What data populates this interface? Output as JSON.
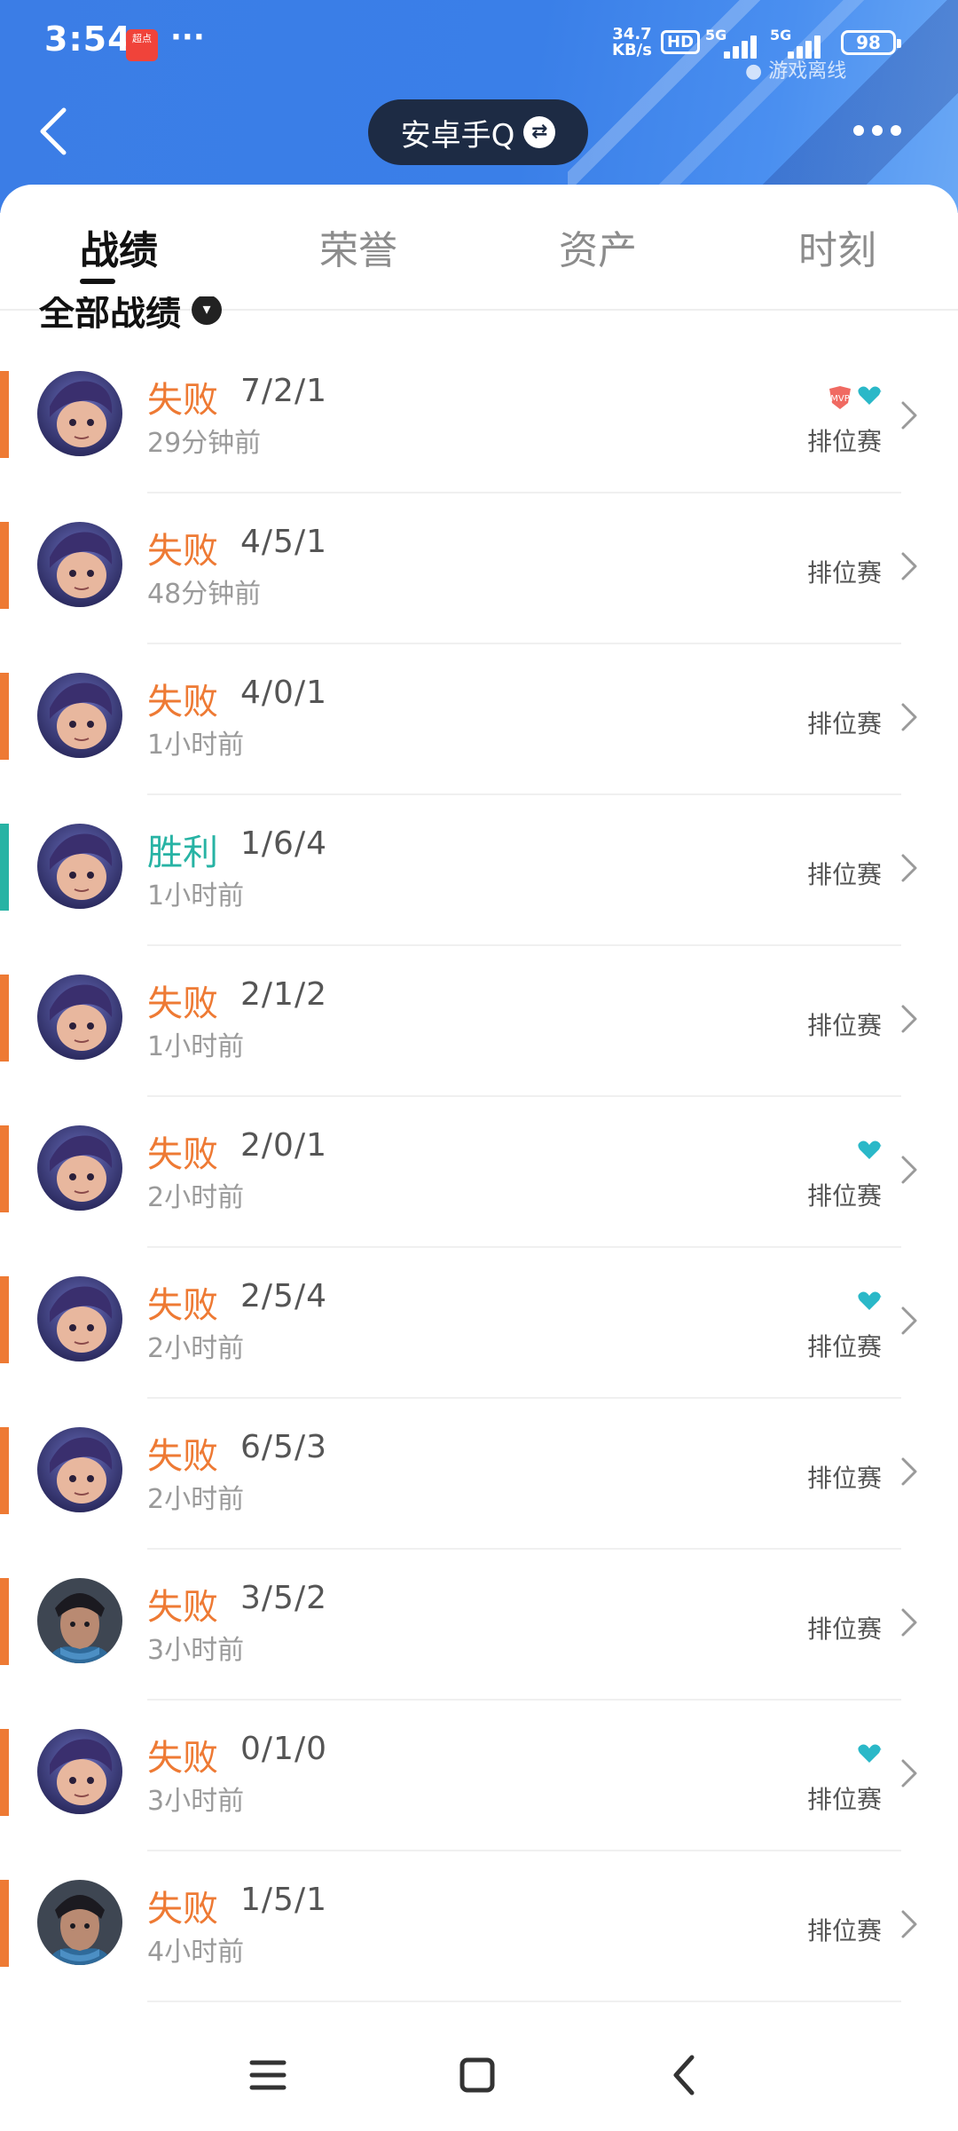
{
  "status_bar": {
    "time": "3:54",
    "app_badge": "超点",
    "dots": "···",
    "net_speed_value": "34.7",
    "net_speed_unit": "KB/s",
    "hd": "HD",
    "sim1": "5G",
    "sim2": "5G",
    "battery": "98",
    "offline_text": "● 游戏离线"
  },
  "header": {
    "account": "安卓手Q",
    "switch_icon": "switch-arrows-icon",
    "back_icon": "back-chevron-icon",
    "more_icon": "more-dots-icon"
  },
  "tabs": [
    {
      "label": "战绩",
      "active": true
    },
    {
      "label": "荣誉",
      "active": false
    },
    {
      "label": "资产",
      "active": false
    },
    {
      "label": "时刻",
      "active": false
    }
  ],
  "section": {
    "label": "全部战绩"
  },
  "colors": {
    "loss": "#ee7a34",
    "win": "#27b3a4",
    "header_blue": "#3a7fe8"
  },
  "matches": [
    {
      "result": "失败",
      "outcome": "loss",
      "kda": "7/2/1",
      "time_ago": "29分钟前",
      "mode": "排位赛",
      "badges": [
        "mvp",
        "heart"
      ],
      "hero": "hero-a"
    },
    {
      "result": "失败",
      "outcome": "loss",
      "kda": "4/5/1",
      "time_ago": "48分钟前",
      "mode": "排位赛",
      "badges": [],
      "hero": "hero-a"
    },
    {
      "result": "失败",
      "outcome": "loss",
      "kda": "4/0/1",
      "time_ago": "1小时前",
      "mode": "排位赛",
      "badges": [],
      "hero": "hero-a"
    },
    {
      "result": "胜利",
      "outcome": "win",
      "kda": "1/6/4",
      "time_ago": "1小时前",
      "mode": "排位赛",
      "badges": [],
      "hero": "hero-a"
    },
    {
      "result": "失败",
      "outcome": "loss",
      "kda": "2/1/2",
      "time_ago": "1小时前",
      "mode": "排位赛",
      "badges": [],
      "hero": "hero-a"
    },
    {
      "result": "失败",
      "outcome": "loss",
      "kda": "2/0/1",
      "time_ago": "2小时前",
      "mode": "排位赛",
      "badges": [
        "heart"
      ],
      "hero": "hero-a"
    },
    {
      "result": "失败",
      "outcome": "loss",
      "kda": "2/5/4",
      "time_ago": "2小时前",
      "mode": "排位赛",
      "badges": [
        "heart"
      ],
      "hero": "hero-a"
    },
    {
      "result": "失败",
      "outcome": "loss",
      "kda": "6/5/3",
      "time_ago": "2小时前",
      "mode": "排位赛",
      "badges": [],
      "hero": "hero-a"
    },
    {
      "result": "失败",
      "outcome": "loss",
      "kda": "3/5/2",
      "time_ago": "3小时前",
      "mode": "排位赛",
      "badges": [],
      "hero": "hero-b"
    },
    {
      "result": "失败",
      "outcome": "loss",
      "kda": "0/1/0",
      "time_ago": "3小时前",
      "mode": "排位赛",
      "badges": [
        "heart"
      ],
      "hero": "hero-a"
    },
    {
      "result": "失败",
      "outcome": "loss",
      "kda": "1/5/1",
      "time_ago": "4小时前",
      "mode": "排位赛",
      "badges": [],
      "hero": "hero-b"
    }
  ],
  "nav": {
    "menu_icon": "menu-icon",
    "home_icon": "home-square-icon",
    "back_icon": "nav-back-icon"
  }
}
